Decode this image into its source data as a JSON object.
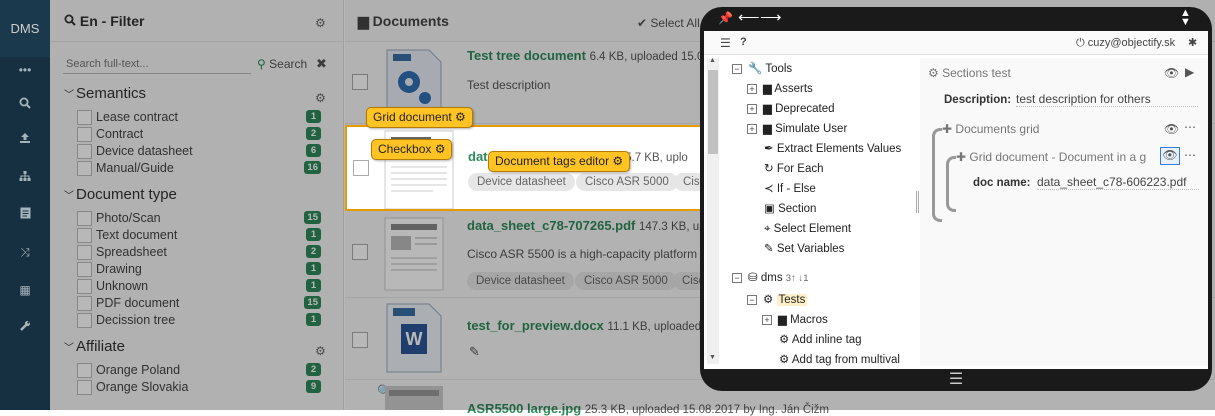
{
  "app": {
    "logo": "DMS",
    "nav_icons": [
      "more-icon",
      "search-icon",
      "upload-icon",
      "sitemap-icon",
      "document-icon",
      "shuffle-icon",
      "grid-icon",
      "wrench-icon"
    ]
  },
  "filter": {
    "title": "En - Filter",
    "search_placeholder": "Search full-text...",
    "search_label": "Search",
    "groups": [
      {
        "name": "Semantics",
        "items": [
          {
            "label": "Lease contract",
            "count": "1"
          },
          {
            "label": "Contract",
            "count": "2"
          },
          {
            "label": "Device datasheet",
            "count": "6"
          },
          {
            "label": "Manual/Guide",
            "count": "16"
          }
        ]
      },
      {
        "name": "Document type",
        "items": [
          {
            "label": "Photo/Scan",
            "count": "15"
          },
          {
            "label": "Text document",
            "count": "1"
          },
          {
            "label": "Spreadsheet",
            "count": "2"
          },
          {
            "label": "Drawing",
            "count": "1"
          },
          {
            "label": "Unknown",
            "count": "1"
          },
          {
            "label": "PDF document",
            "count": "15"
          },
          {
            "label": "Decission tree",
            "count": "1"
          }
        ]
      },
      {
        "name": "Affiliate",
        "items": [
          {
            "label": "Orange Poland",
            "count": "2"
          },
          {
            "label": "Orange Slovakia",
            "count": "9"
          }
        ]
      }
    ]
  },
  "documents": {
    "title": "Documents",
    "select_all": "Select All",
    "rows": [
      {
        "title": "Test tree document",
        "meta": "6.4 KB, uploaded 15.0",
        "desc": "Test description",
        "tags": []
      },
      {
        "title": "data",
        "meta": "95.7 KB, uplo",
        "desc": "",
        "tags": [
          "Device datasheet",
          "Cisco ASR 5000",
          "Cisc"
        ]
      },
      {
        "title": "data_sheet_c78-707265.pdf",
        "meta": "147.3 KB, uplo",
        "desc": "Cisco ASR 5500 is a high-capacity platform des",
        "tags": [
          "Device datasheet",
          "Cisco ASR 5000",
          "Cisc"
        ]
      },
      {
        "title": "test_for_preview.docx",
        "meta": "11.1 KB, uploaded 1",
        "desc": "",
        "tags": []
      },
      {
        "title": "ASR5500 large.jpg",
        "meta": "25.3 KB, uploaded 15.08.2017 by Ing. Ján Čižm",
        "desc": "",
        "tags": []
      }
    ]
  },
  "callouts": {
    "grid_document": "Grid document",
    "checkbox": "Checkbox",
    "tags_editor": "Document tags editor"
  },
  "panel": {
    "user": "cuzy@objectify.sk",
    "tree": [
      {
        "label": "Tools",
        "exp": "−"
      },
      {
        "label": "Asserts",
        "exp": "+"
      },
      {
        "label": "Deprecated",
        "exp": "+"
      },
      {
        "label": "Simulate User",
        "exp": "+"
      },
      {
        "label": "Extract Elements Values"
      },
      {
        "label": "For Each"
      },
      {
        "label": "If - Else"
      },
      {
        "label": "Section"
      },
      {
        "label": "Select Element"
      },
      {
        "label": "Set Variables"
      },
      {
        "label": "dms",
        "exp": "−",
        "sort": "3↑ ↓1"
      },
      {
        "label": "Tests",
        "exp": "−"
      },
      {
        "label": "Macros",
        "exp": "+"
      },
      {
        "label": "Add inline tag"
      },
      {
        "label": "Add tag from multival"
      }
    ],
    "sections_title": "Sections test",
    "description_label": "Description:",
    "description_value": "test description for others",
    "documents_grid": "Documents grid",
    "grid_document_title": "Grid document - Document in a g",
    "doc_name_label": "doc name:",
    "doc_name_value": "data_sheet_c78-606223.pdf"
  }
}
